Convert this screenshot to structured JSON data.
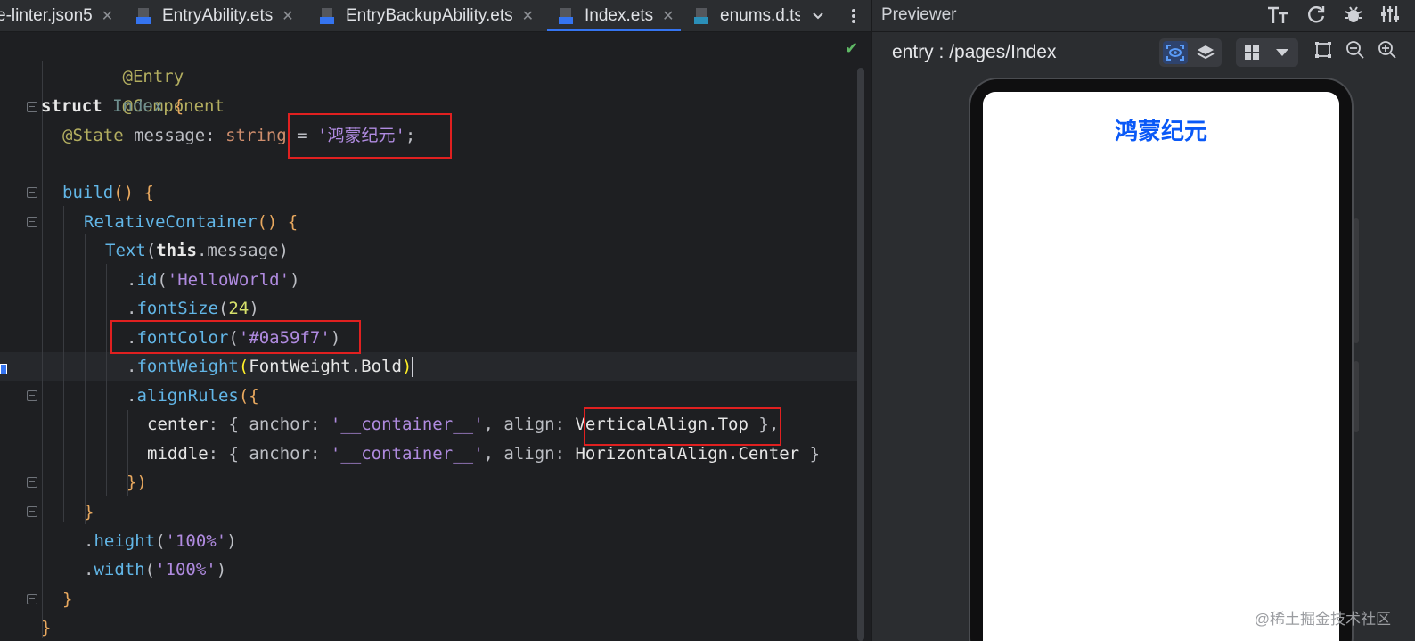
{
  "tabs": [
    {
      "label": "e-linter.json5",
      "icon": "json-file-icon",
      "active": false
    },
    {
      "label": "EntryAbility.ets",
      "icon": "ets-file-icon",
      "active": false
    },
    {
      "label": "EntryBackupAbility.ets",
      "icon": "ets-file-icon",
      "active": false
    },
    {
      "label": "Index.ets",
      "icon": "ets-file-icon",
      "active": true
    },
    {
      "label": "enums.d.ts",
      "icon": "ts-file-icon",
      "active": false
    }
  ],
  "tab_close": "✕",
  "tab_overflow_icon": "chevron-down-icon",
  "tab_more_icon": "more-vertical-icon",
  "code": {
    "l1": "@Entry",
    "l2": "@Component",
    "l3_kw": "struct",
    "l3_name": "Index",
    "l3_brace": "{",
    "l4_dec": "@State",
    "l4_var": "message",
    "l4_colon": ": ",
    "l4_type": "string",
    "l4_eq": " = ",
    "l4_str": "'鸿蒙纪元'",
    "l4_semi": ";",
    "l5_fn": "build",
    "l5_rest": "() {",
    "l6_fn": "RelativeContainer",
    "l6_rest": "() {",
    "l7_fn": "Text",
    "l7_open": "(",
    "l7_this": "this",
    "l7_prop": ".message",
    "l7_close": ")",
    "l8_dot": ".",
    "l8_fn": "id",
    "l8_open": "(",
    "l8_str": "'HelloWorld'",
    "l8_close": ")",
    "l9_dot": ".",
    "l9_fn": "fontSize",
    "l9_open": "(",
    "l9_num": "24",
    "l9_close": ")",
    "l10_dot": ".",
    "l10_fn": "fontColor",
    "l10_open": "(",
    "l10_str": "'#0a59f7'",
    "l10_close": ")",
    "l11_dot": ".",
    "l11_fn": "fontWeight",
    "l11_open": "(",
    "l11_arg": "FontWeight.Bold",
    "l11_close": ")",
    "l12_dot": ".",
    "l12_fn": "alignRules",
    "l12_rest": "({",
    "l13_key": "center",
    "l13_a": ": { anchor: ",
    "l13_str": "'__container__'",
    "l13_b": ", align: ",
    "l13_val": "VerticalAlign.Top",
    "l13_end": " },",
    "l14_key": "middle",
    "l14_a": ": { anchor: ",
    "l14_str": "'__container__'",
    "l14_b": ", align: ",
    "l14_val": "HorizontalAlign.Center",
    "l14_end": " }",
    "l15": "})",
    "l16": "}",
    "l17_dot": ".",
    "l17_fn": "height",
    "l17_open": "(",
    "l17_str": "'100%'",
    "l17_close": ")",
    "l18_dot": ".",
    "l18_fn": "width",
    "l18_open": "(",
    "l18_str": "'100%'",
    "l18_close": ")",
    "l19": "}",
    "l20": "}"
  },
  "inspection_status_icon": "check-icon",
  "previewer": {
    "title": "Previewer",
    "route": "entry : /pages/Index",
    "header_icons": [
      "font-size-icon",
      "refresh-icon",
      "debug-icon",
      "settings-icon"
    ],
    "toolbar_icons": [
      "inspect-icon",
      "layers-icon",
      "grid-icon",
      "dropdown-icon",
      "fit-icon",
      "zoom-out-icon",
      "zoom-in-icon"
    ],
    "screen_text": "鸿蒙纪元",
    "text_color": "#0a59f7"
  },
  "watermark": "@稀土掘金技术社区"
}
